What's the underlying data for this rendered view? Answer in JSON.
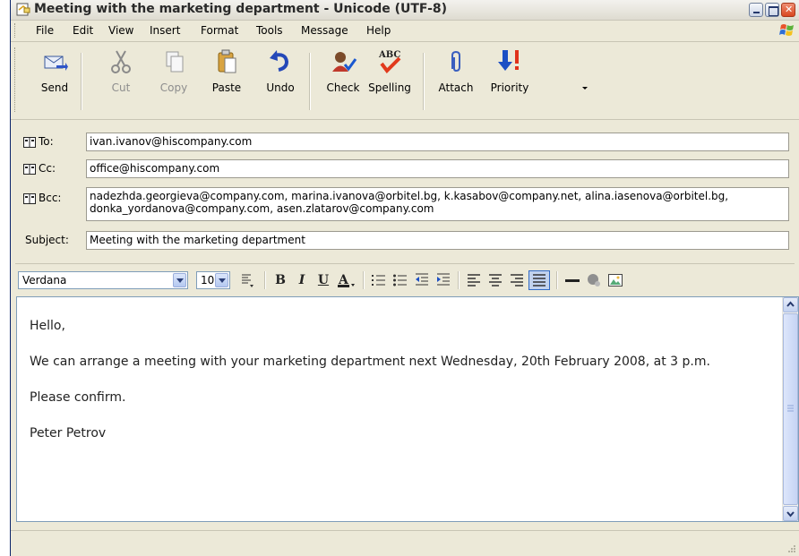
{
  "window": {
    "title": "Meeting with the marketing department - Unicode (UTF-8)"
  },
  "menu": [
    "File",
    "Edit",
    "View",
    "Insert",
    "Format",
    "Tools",
    "Message",
    "Help"
  ],
  "toolbar": {
    "send": "Send",
    "cut": "Cut",
    "copy": "Copy",
    "paste": "Paste",
    "undo": "Undo",
    "check": "Check",
    "spelling": "Spelling",
    "attach": "Attach",
    "priority": "Priority"
  },
  "headers": {
    "to_label": "To:",
    "to_value": "ivan.ivanov@hiscompany.com",
    "cc_label": "Cc:",
    "cc_value": "office@hiscompany.com",
    "bcc_label": "Bcc:",
    "bcc_value": "nadezhda.georgieva@company.com, marina.ivanova@orbitel.bg,  k.kasabov@company.net, alina.iasenova@orbitel.bg, donka_yordanova@company.com, asen.zlatarov@company.com",
    "subject_label": "Subject:",
    "subject_value": "Meeting with the marketing department"
  },
  "format": {
    "font": "Verdana",
    "size": "10"
  },
  "body": {
    "greeting": "Hello,",
    "paragraph": "We can arrange a meeting with your marketing department next Wednesday, 20th February 2008, at 3 p.m.",
    "confirm": "Please confirm.",
    "signature": "Peter Petrov"
  },
  "colors": {
    "chrome": "#ece9d8",
    "field_border": "#7f9db9",
    "accent_blue": "#2f55c8",
    "accent_red": "#d9461f"
  }
}
